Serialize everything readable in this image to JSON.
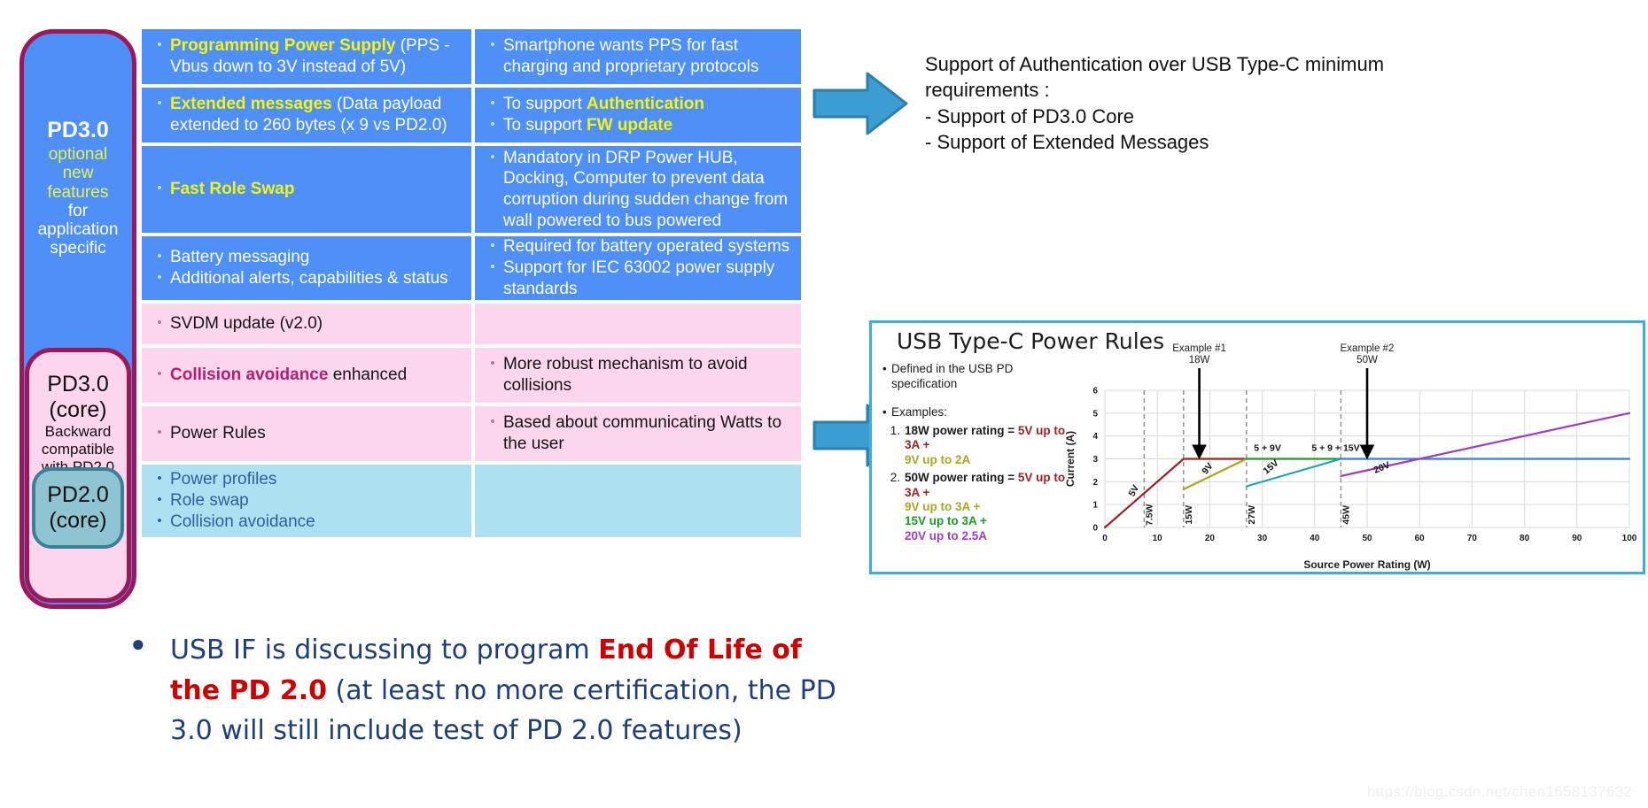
{
  "left_stack": {
    "pd30_optional": {
      "title": "PD3.0",
      "lines": [
        "optional",
        "new",
        "features",
        "for",
        "application",
        "specific"
      ],
      "highlight_color": "#e8f24a",
      "bg_color": "#4e90f7",
      "border_color": "#9E1759"
    },
    "pd30_core": {
      "title_line1": "PD3.0",
      "title_line2": "(core)",
      "sub_lines": [
        "Backward",
        "compatible",
        "with PD2.0"
      ],
      "bg_color": "#fbd6ec"
    },
    "pd20_core": {
      "title_line1": "PD2.0",
      "title_line2": "(core)",
      "bg_color": "#8fc4d3",
      "border_color": "#3b7f99"
    }
  },
  "feature_table": {
    "rows": [
      {
        "style": "blue",
        "left": [
          {
            "strong": "Programming Power Supply",
            "rest": " (PPS - Vbus down to 3V instead of 5V)"
          }
        ],
        "right": [
          {
            "strong": "",
            "rest": "Smartphone wants PPS for fast charging and proprietary protocols"
          }
        ]
      },
      {
        "style": "blue",
        "left": [
          {
            "strong": "Extended messages",
            "rest": " (Data payload extended to 260 bytes (x 9 vs PD2.0)"
          }
        ],
        "right": [
          {
            "strong": "",
            "rest": "To support ",
            "tail_strong": "Authentication"
          },
          {
            "strong": "",
            "rest": "To support ",
            "tail_strong": "FW update"
          }
        ]
      },
      {
        "style": "blue",
        "left": [
          {
            "strong": "Fast Role Swap",
            "rest": ""
          }
        ],
        "right": [
          {
            "strong": "",
            "rest": "Mandatory in DRP Power HUB, Docking, Computer to prevent data corruption during sudden change from wall powered to bus powered"
          }
        ]
      },
      {
        "style": "blue",
        "left": [
          {
            "strong": "",
            "rest": "Battery messaging"
          },
          {
            "strong": "",
            "rest": "Additional alerts, capabilities & status"
          }
        ],
        "right": [
          {
            "strong": "",
            "rest": "Required for battery operated systems"
          },
          {
            "strong": "",
            "rest": "Support for IEC 63002 power supply standards"
          }
        ]
      },
      {
        "style": "pink",
        "left": [
          {
            "strong": "",
            "rest": "SVDM update (v2.0)"
          }
        ],
        "right": []
      },
      {
        "style": "pink",
        "left": [
          {
            "strong": "Collision avoidance",
            "rest": " enhanced"
          }
        ],
        "right": [
          {
            "strong": "",
            "rest": "More robust mechanism to avoid collisions"
          }
        ]
      },
      {
        "style": "pink",
        "left": [
          {
            "strong": "",
            "rest": "Power Rules"
          }
        ],
        "right": [
          {
            "strong": "",
            "rest": "Based about communicating Watts to the user"
          }
        ]
      },
      {
        "style": "ltblue",
        "left": [
          {
            "strong": "",
            "rest": "Power profiles"
          },
          {
            "strong": "",
            "rest": "Role swap"
          },
          {
            "strong": "",
            "rest": "Collision avoidance"
          }
        ],
        "right": []
      }
    ]
  },
  "auth_note": {
    "line1": "Support of Authentication over USB Type-C minimum",
    "line2": "requirements :",
    "line3": "- Support of PD3.0 Core",
    "line4": "- Support of Extended Messages"
  },
  "bottom_bullet": {
    "bullet_glyph": "●",
    "part1": "USB IF is discussing to program ",
    "highlight": "End Of Life of the PD 2.0",
    "part2": " (at least no more certification, the PD 3.0 will still include test of PD 2.0 features)",
    "highlight_color": "#cc0000",
    "text_color": "#1f3f7a"
  },
  "chart_panel": {
    "title": "USB Type-C Power Rules",
    "bullet1": "Defined in the USB PD specification",
    "bullet2": "Examples:",
    "example1": {
      "number": "1.",
      "head": "18W power rating = ",
      "l1": "5V up to 3A +",
      "l2": "9V up to 2A"
    },
    "example2": {
      "number": "2.",
      "head": "50W power rating = ",
      "l1": "5V up to 3A +",
      "l2": "9V up to 3A +",
      "l3": "15V up to 3A +",
      "l4": "20V up to 2.5A"
    }
  },
  "chart_data": {
    "type": "line",
    "title": "USB Type-C Power Rules",
    "xlabel": "Source Power Rating (W)",
    "ylabel": "Current (A)",
    "xlim": [
      0,
      100
    ],
    "ylim": [
      0,
      6
    ],
    "xticks": [
      0,
      10,
      20,
      30,
      40,
      50,
      60,
      70,
      80,
      90,
      100
    ],
    "yticks": [
      0,
      1,
      2,
      3,
      4,
      5,
      6
    ],
    "grid": true,
    "legend": "none",
    "series": [
      {
        "name": "5V",
        "color": "#a32020",
        "points": [
          [
            0,
            0
          ],
          [
            15,
            3
          ],
          [
            27,
            3
          ]
        ]
      },
      {
        "name": "9V",
        "color": "#a8a81f",
        "points": [
          [
            15,
            1.67
          ],
          [
            27,
            3
          ]
        ]
      },
      {
        "name": "5 + 9V",
        "color": "#17a01f",
        "points": [
          [
            27,
            3
          ],
          [
            45,
            3
          ]
        ]
      },
      {
        "name": "15V",
        "color": "#17a8b0",
        "points": [
          [
            27,
            1.8
          ],
          [
            45,
            3
          ]
        ]
      },
      {
        "name": "5 + 9 + 15V",
        "color": "#2f7fe8",
        "points": [
          [
            45,
            3
          ],
          [
            100,
            3
          ]
        ]
      },
      {
        "name": "20V",
        "color": "#a03bc4",
        "points": [
          [
            45,
            2.25
          ],
          [
            100,
            5
          ]
        ]
      }
    ],
    "vlines": [
      {
        "x": 7.5,
        "label": "7.5W"
      },
      {
        "x": 15,
        "label": "15W"
      },
      {
        "x": 27,
        "label": "27W"
      },
      {
        "x": 45,
        "label": "45W"
      }
    ],
    "inline_labels": [
      {
        "text": "5V",
        "x": 6,
        "y": 1.55,
        "rot": -62,
        "color": "#111111"
      },
      {
        "text": "9V",
        "x": 20,
        "y": 2.5,
        "rot": -52,
        "color": "#111111"
      },
      {
        "text": "15V",
        "x": 32,
        "y": 2.55,
        "rot": -40,
        "color": "#111111"
      },
      {
        "text": "20V",
        "x": 53,
        "y": 2.5,
        "rot": -22,
        "color": "#111111"
      },
      {
        "text": "5 + 9V",
        "x": 31,
        "y": 3.35,
        "rot": 0,
        "color": "#111111"
      },
      {
        "text": "5 + 9 + 15V",
        "x": 44,
        "y": 3.35,
        "rot": 0,
        "color": "#111111"
      }
    ],
    "annotations": [
      {
        "label_l1": "Example #1",
        "label_l2": "18W",
        "arrow_x": 18,
        "arrow_to_y": 3.05
      },
      {
        "label_l1": "Example #2",
        "label_l2": "50W",
        "arrow_x": 50,
        "arrow_to_y": 3.05
      }
    ]
  },
  "watermark": {
    "text": "https://blog.csdn.net/chen1658137632"
  }
}
